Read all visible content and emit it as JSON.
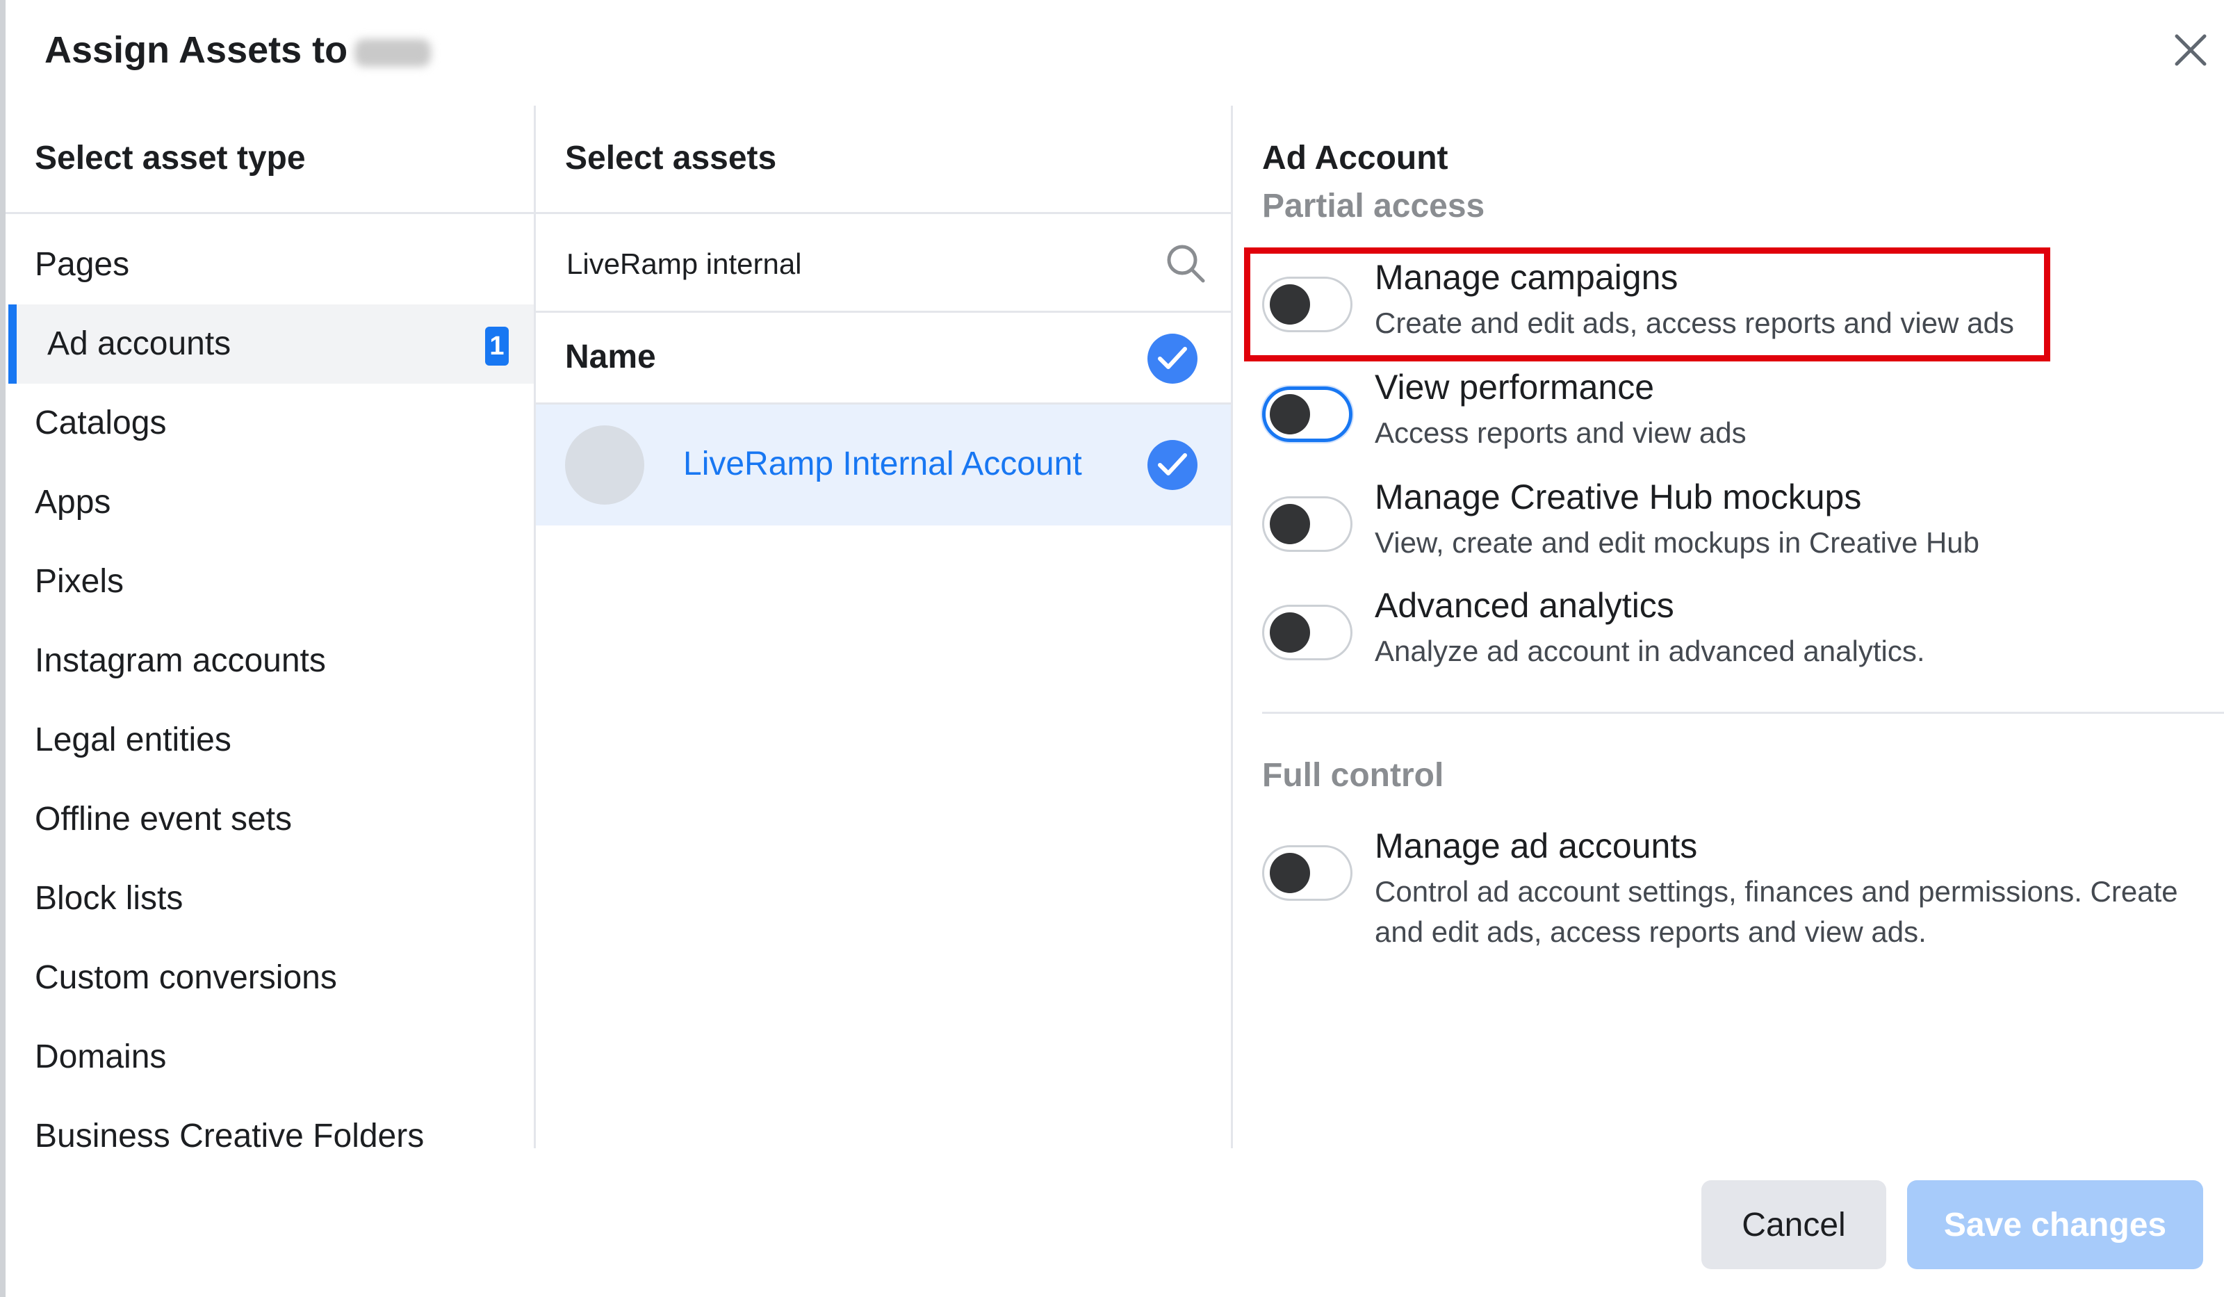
{
  "dialog": {
    "title": "Assign Assets to",
    "close_icon": "close-icon"
  },
  "asset_types": {
    "heading": "Select asset type",
    "items": [
      {
        "label": "Pages"
      },
      {
        "label": "Ad accounts",
        "badge": "1",
        "active": true
      },
      {
        "label": "Catalogs"
      },
      {
        "label": "Apps"
      },
      {
        "label": "Pixels"
      },
      {
        "label": "Instagram accounts"
      },
      {
        "label": "Legal entities"
      },
      {
        "label": "Offline event sets"
      },
      {
        "label": "Block lists"
      },
      {
        "label": "Custom conversions"
      },
      {
        "label": "Domains"
      },
      {
        "label": "Business Creative Folders"
      }
    ]
  },
  "assets": {
    "heading": "Select assets",
    "search_value": "LiveRamp internal",
    "name_header": "Name",
    "rows": [
      {
        "name": "LiveRamp Internal Account",
        "selected": true
      }
    ]
  },
  "permissions": {
    "heading": "Ad Account",
    "partial_label": "Partial access",
    "partial": [
      {
        "title": "Manage campaigns",
        "desc": "Create and edit ads, access reports and view ads",
        "on": false
      },
      {
        "title": "View performance",
        "desc": "Access reports and view ads",
        "on": false,
        "focused": true
      },
      {
        "title": "Manage Creative Hub mockups",
        "desc": "View, create and edit mockups in Creative Hub",
        "on": false
      },
      {
        "title": "Advanced analytics",
        "desc": "Analyze ad account in advanced analytics.",
        "on": false
      }
    ],
    "full_label": "Full control",
    "full": [
      {
        "title": "Manage ad accounts",
        "desc": "Control ad account settings, finances and permissions. Create and edit ads, access reports and view ads.",
        "on": false
      }
    ]
  },
  "footer": {
    "cancel_label": "Cancel",
    "save_label": "Save changes"
  },
  "colors": {
    "accent": "#1877f2",
    "highlight_box": "#e0000b",
    "save_disabled": "#a7cbfa"
  }
}
